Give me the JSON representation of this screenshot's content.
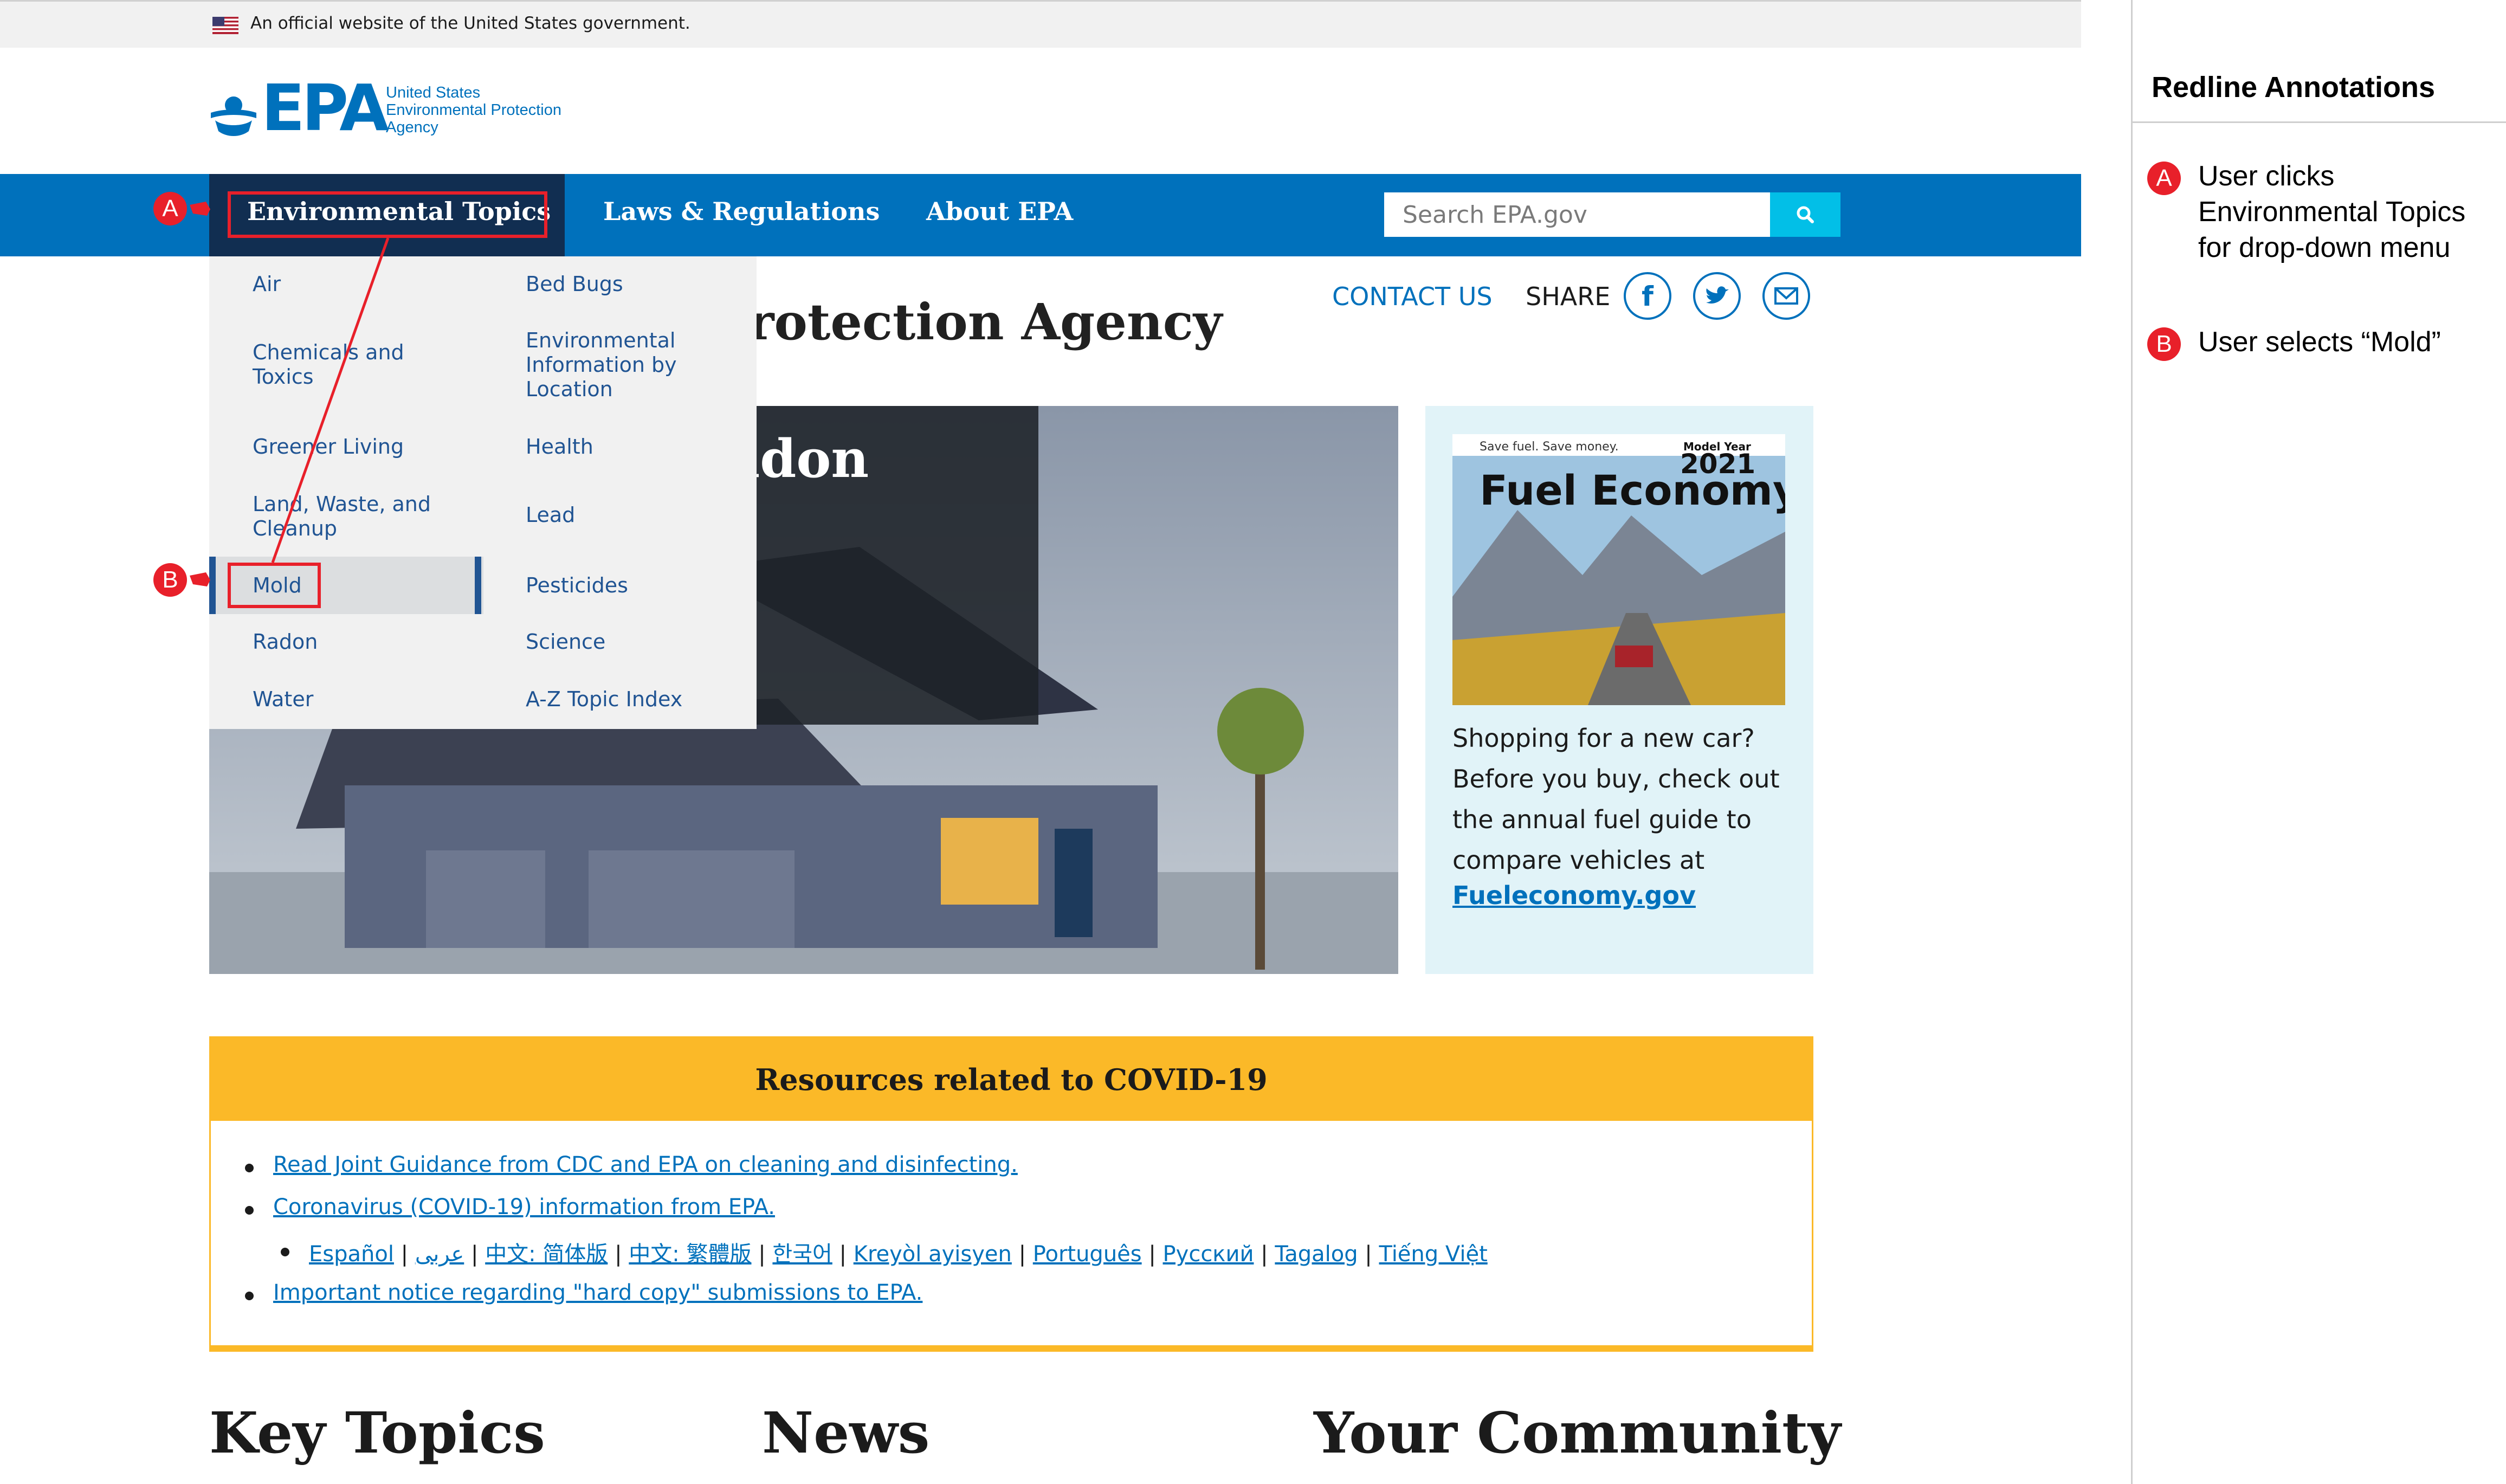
{
  "gov_banner": {
    "text": "An official website of the United States government."
  },
  "logo": {
    "wordmark": "EPA",
    "line1": "United States",
    "line2": "Environmental Protection",
    "line3": "Agency"
  },
  "nav": {
    "items": [
      "Environmental Topics",
      "Laws & Regulations",
      "About EPA"
    ],
    "active_index": 0,
    "search_placeholder": "Search EPA.gov"
  },
  "utility": {
    "contact": "CONTACT US",
    "share": "SHARE"
  },
  "page": {
    "title_visible": "rotection Agency"
  },
  "hero": {
    "title_visible": "adon"
  },
  "dropdown": {
    "col1": [
      "Air",
      "Chemicals and Toxics",
      "Greener Living",
      "Land, Waste, and Cleanup",
      "Mold",
      "Radon",
      "Water"
    ],
    "col2": [
      "Bed Bugs",
      "Environmental Information by Location",
      "Health",
      "Lead",
      "Pesticides",
      "Science",
      "A-Z Topic Index"
    ],
    "selected": "Mold"
  },
  "sidebar_promo": {
    "image_top_left": "Save fuel. Save money.",
    "image_model_year_label": "Model Year",
    "image_year": "2021",
    "image_title": "Fuel Economy Guide",
    "text": "Shopping for a new car? Before you buy, check out the annual fuel guide to compare vehicles at",
    "link": "Fueleconomy.gov"
  },
  "covid": {
    "title": "Resources related to COVID-19",
    "link1": "Read Joint Guidance from CDC and EPA on cleaning and disinfecting.",
    "link2": "Coronavirus (COVID-19) information from EPA.",
    "languages": [
      "Español",
      "عربى",
      "中文: 简体版",
      "中文: 繁體版",
      "한국어",
      "Kreyòl ayisyen",
      "Português",
      "Русский",
      "Tagalog",
      "Tiếng Việt"
    ],
    "link3": "Important notice regarding \"hard copy\" submissions to EPA."
  },
  "bottom_headings": [
    "Key Topics",
    "News",
    "Your Community"
  ],
  "annotations": {
    "panel_title": "Redline Annotations",
    "items": [
      {
        "marker": "A",
        "text": "User clicks Environmental Topics for drop-down menu"
      },
      {
        "marker": "B",
        "text": "User selects “Mold”"
      }
    ]
  },
  "colors": {
    "epa_blue": "#0071bc",
    "nav_active": "#112e51",
    "covid_yellow": "#fbb928",
    "annotation_red": "#e8202a"
  }
}
